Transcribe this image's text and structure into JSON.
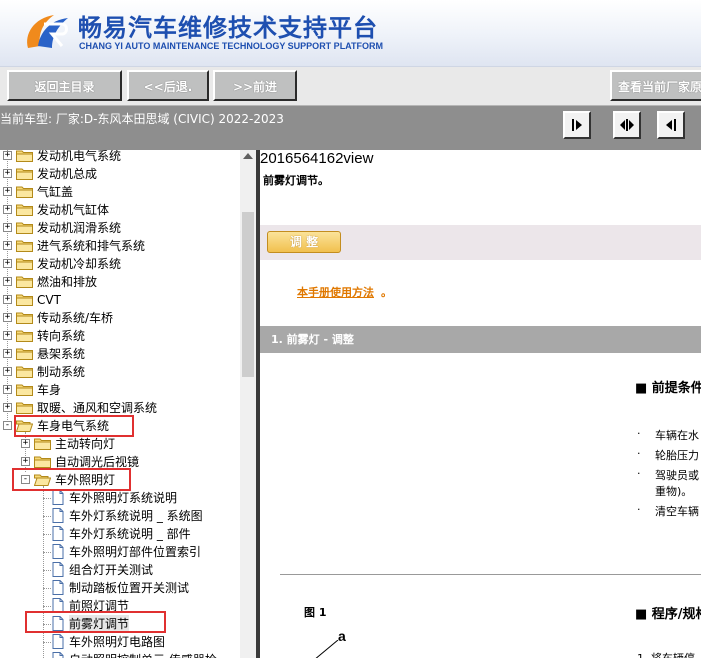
{
  "header": {
    "title_cn": "畅易汽车维修技术支持平台",
    "title_en": "CHANG YI AUTO MAINTENANCE TECHNOLOGY SUPPORT PLATFORM",
    "brand_color": "#1e4fb0"
  },
  "toolbar": {
    "home_label": "返回主目录",
    "back_label": "<<后退.",
    "forward_label": ">>前进",
    "view_label": "查看当前厂家原"
  },
  "status": {
    "current_model": "当前车型:   厂家:D-东风本田思域 (CIVIC) 2022-2023"
  },
  "tree": {
    "items": [
      {
        "label": "发动机电气系统"
      },
      {
        "label": "发动机总成"
      },
      {
        "label": "气缸盖"
      },
      {
        "label": "发动机气缸体"
      },
      {
        "label": "发动机润滑系统"
      },
      {
        "label": "进气系统和排气系统"
      },
      {
        "label": "发动机冷却系统"
      },
      {
        "label": "燃油和排放"
      },
      {
        "label": "CVT"
      },
      {
        "label": "传动系统/车桥"
      },
      {
        "label": "转向系统"
      },
      {
        "label": "悬架系统"
      },
      {
        "label": "制动系统"
      },
      {
        "label": "车身"
      },
      {
        "label": "取暖、通风和空调系统"
      },
      {
        "label": "车身电气系统"
      },
      {
        "label": "主动转向灯"
      },
      {
        "label": "自动调光后视镜"
      },
      {
        "label": "车外照明灯"
      },
      {
        "label": "车外照明灯系统说明"
      },
      {
        "label": "车外灯系统说明 _ 系统图"
      },
      {
        "label": "车外灯系统说明 _ 部件"
      },
      {
        "label": "车外照明灯部件位置索引"
      },
      {
        "label": "组合灯开关测试"
      },
      {
        "label": "制动踏板位置开关测试"
      },
      {
        "label": "前照灯调节"
      },
      {
        "label": "前雾灯调节"
      },
      {
        "label": "车外照明灯电路图"
      },
      {
        "label": "自动照明控制单元 传感器检"
      }
    ]
  },
  "content": {
    "doc_id": "2016564162view",
    "doc_subtitle": "前雾灯调节。",
    "adjust_button": "调 整",
    "manual_link": "本手册使用方法",
    "manual_dot": "。",
    "section_header": "1. 前雾灯 - 调整",
    "prereq_title": "■ 前提条件",
    "prereq_items": [
      {
        "bullet": "·",
        "text": "车辆在水"
      },
      {
        "bullet": "·",
        "text": "轮胎压力"
      },
      {
        "bullet": "·",
        "text": "驾驶员或"
      },
      {
        "bullet": "",
        "text": "重物)。"
      },
      {
        "bullet": "·",
        "text": "清空车辆"
      }
    ],
    "figure_label": "图 1",
    "figure_marker": "a",
    "procedure_title": "■ 程序/规格",
    "procedure_first": "1.  将车辆停"
  }
}
